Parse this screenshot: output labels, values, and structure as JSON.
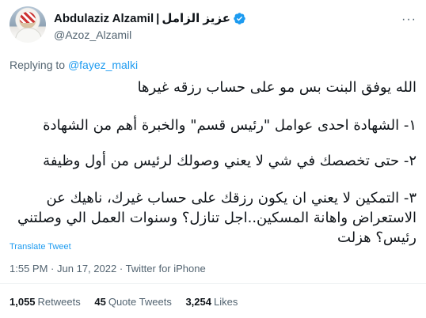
{
  "author": {
    "display_name": "Abdulaziz Alzamil",
    "separator": "|",
    "arabic_name": "عزيز الزامل",
    "handle": "@Azoz_Alzamil",
    "verified_icon": "verified-badge-icon"
  },
  "reply": {
    "prefix": "Replying to",
    "mention": "@fayez_malki"
  },
  "tweet": {
    "lines": [
      "الله يوفق البنت بس مو على حساب رزقه غيرها",
      "١- الشهادة احدى عوامل \"رئيس قسم\" والخبرة أهم من الشهادة",
      "٢- حتى تخصصك في شي لا يعني وصولك لرئيس من أول وظيفة",
      "٣- التمكين لا يعني ان يكون رزقك على حساب غيرك، ناهيك عن الاستعراض واهانة المسكين..اجل تنازل؟ وسنوات العمل الي وصلتني رئيس؟ هزلت"
    ]
  },
  "translate_label": "Translate Tweet",
  "meta": {
    "time": "1:55 PM",
    "dot1": "·",
    "date": "Jun 17, 2022",
    "dot2": "·",
    "source": "Twitter for iPhone"
  },
  "stats": {
    "retweets_count": "1,055",
    "retweets_label": "Retweets",
    "quotes_count": "45",
    "quotes_label": "Quote Tweets",
    "likes_count": "3,254",
    "likes_label": "Likes"
  },
  "colors": {
    "accent": "#1d9bf0",
    "text": "#0f1419",
    "secondary": "#536471"
  }
}
